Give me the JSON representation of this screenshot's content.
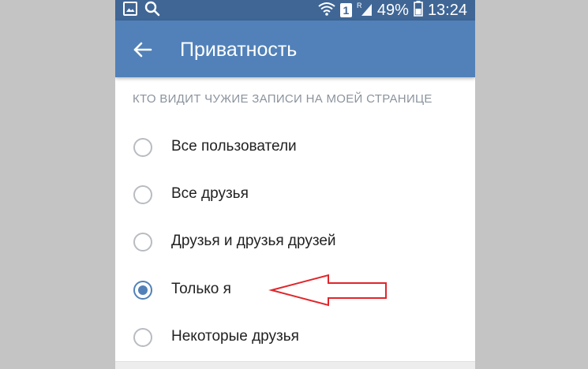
{
  "status_bar": {
    "battery_percent": "49%",
    "time": "13:24",
    "sim_slot": "1",
    "left_icons": [
      "image-icon",
      "search-icon"
    ],
    "right_icons": [
      "wifi-icon",
      "sim-icon",
      "signal-icon",
      "battery-icon"
    ]
  },
  "app_bar": {
    "title": "Приватность",
    "back_icon": "arrow-left-icon",
    "color": "#5181b8"
  },
  "section": {
    "header": "КТО ВИДИТ ЧУЖИЕ ЗАПИСИ НА МОЕЙ СТРАНИЦЕ",
    "options": [
      {
        "label": "Все пользователи",
        "selected": false
      },
      {
        "label": "Все друзья",
        "selected": false
      },
      {
        "label": "Друзья и друзья друзей",
        "selected": false
      },
      {
        "label": "Только я",
        "selected": true
      },
      {
        "label": "Некоторые друзья",
        "selected": false
      }
    ]
  },
  "annotation": {
    "type": "red-outline-arrow",
    "points_to": "Только я",
    "color": "#e0262b"
  }
}
